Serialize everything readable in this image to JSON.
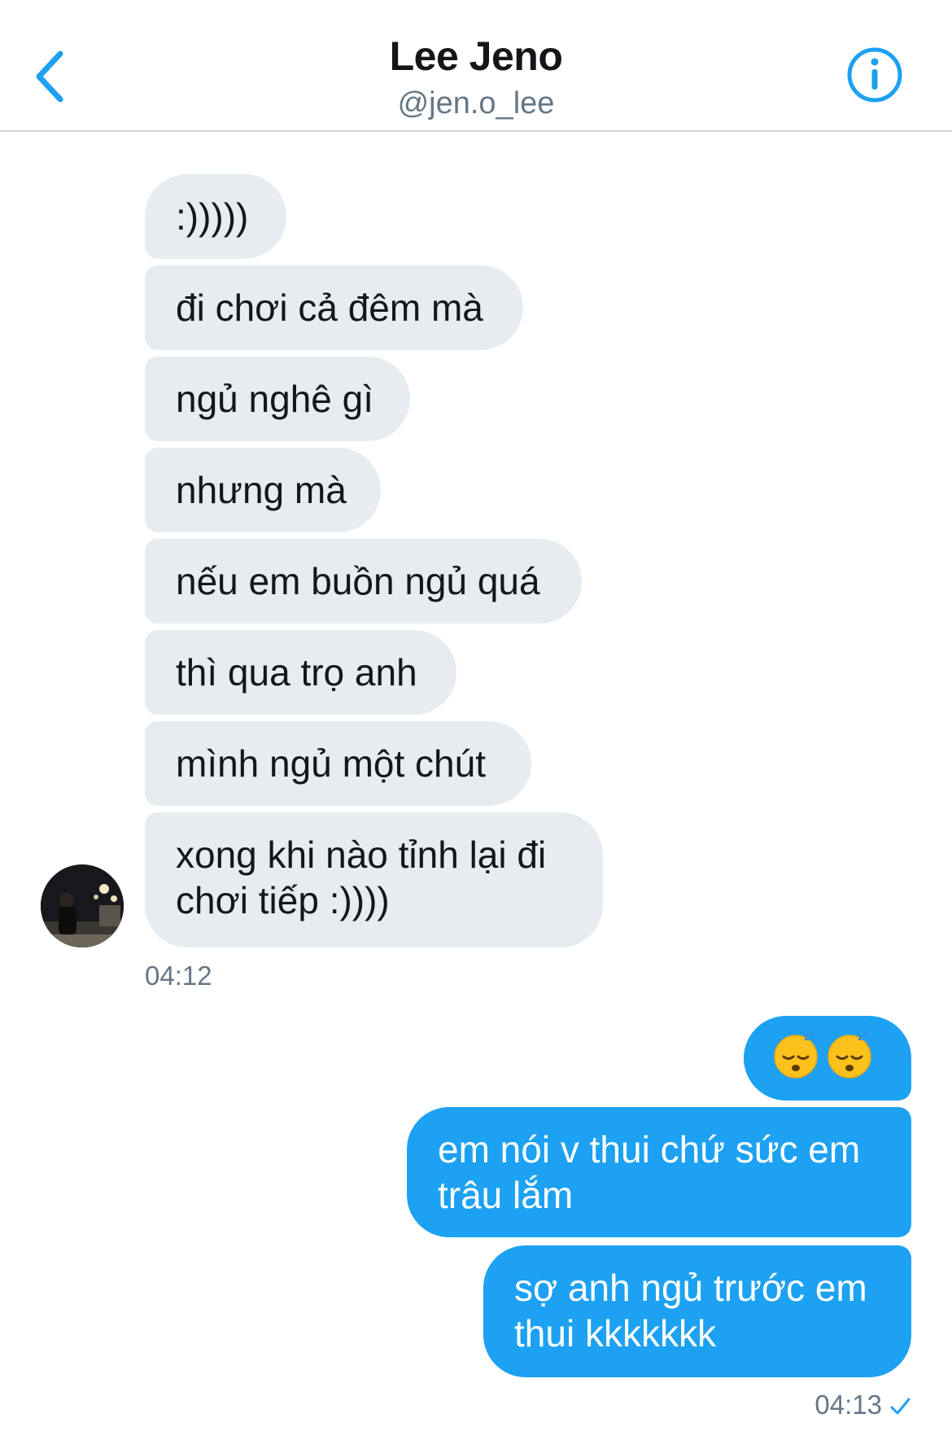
{
  "header": {
    "title": "Lee Jeno",
    "handle": "@jen.o_lee",
    "back_icon": "chevron-left-icon",
    "info_icon": "info-icon",
    "accent_color": "#1da1f2"
  },
  "conversation": {
    "incoming": [
      ":)))))",
      "đi chơi cả đêm mà",
      "ngủ nghê gì",
      "nhưng mà",
      "nếu em buồn ngủ quá",
      "thì qua trọ anh",
      "mình ngủ một chút",
      "xong khi nào tỉnh lại đi",
      "chơi tiếp :))))"
    ],
    "incoming_time": "04:12",
    "outgoing": {
      "emoji": [
        "sleeping-face-emoji",
        "sleeping-face-emoji"
      ],
      "msg1_line1": "em nói v thui chứ sức em",
      "msg1_line2": "trâu lắm",
      "msg2_line1": "sợ anh ngủ trước em",
      "msg2_line2": "thui kkkkkkk"
    },
    "outgoing_time": "04:13",
    "read_icon": "checkmark-icon"
  }
}
